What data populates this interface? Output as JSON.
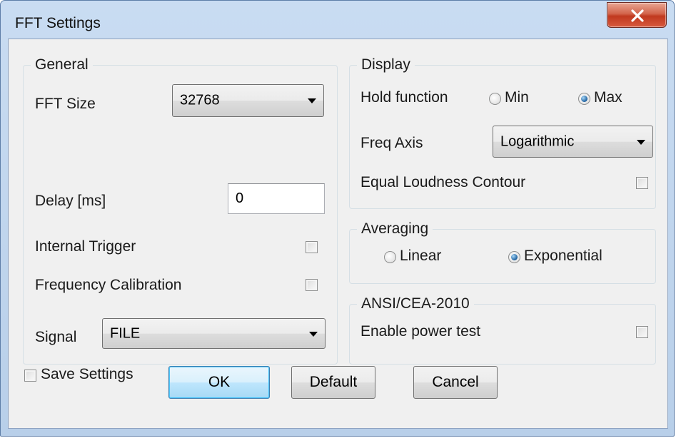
{
  "window": {
    "title": "FFT Settings",
    "close_icon": "close-x-icon"
  },
  "general": {
    "group_label": "General",
    "fft_size_label": "FFT Size",
    "fft_size_value": "32768",
    "delay_label": "Delay [ms]",
    "delay_value": "0",
    "internal_trigger_label": "Internal Trigger",
    "internal_trigger_checked": false,
    "freq_cal_label": "Frequency Calibration",
    "freq_cal_checked": false,
    "signal_label": "Signal",
    "signal_value": "FILE"
  },
  "display": {
    "group_label": "Display",
    "hold_label": "Hold function",
    "hold_min": "Min",
    "hold_max": "Max",
    "hold_selected": "Max",
    "freq_axis_label": "Freq Axis",
    "freq_axis_value": "Logarithmic",
    "equal_loudness_label": "Equal Loudness Contour",
    "equal_loudness_checked": false
  },
  "averaging": {
    "group_label": "Averaging",
    "linear": "Linear",
    "exponential": "Exponential",
    "selected": "Exponential"
  },
  "ansi": {
    "group_label": "ANSI/CEA-2010",
    "power_test_label": "Enable power test",
    "power_test_checked": false
  },
  "footer": {
    "save_settings_label": "Save Settings",
    "save_settings_checked": false,
    "ok_label": "OK",
    "default_label": "Default",
    "cancel_label": "Cancel"
  }
}
